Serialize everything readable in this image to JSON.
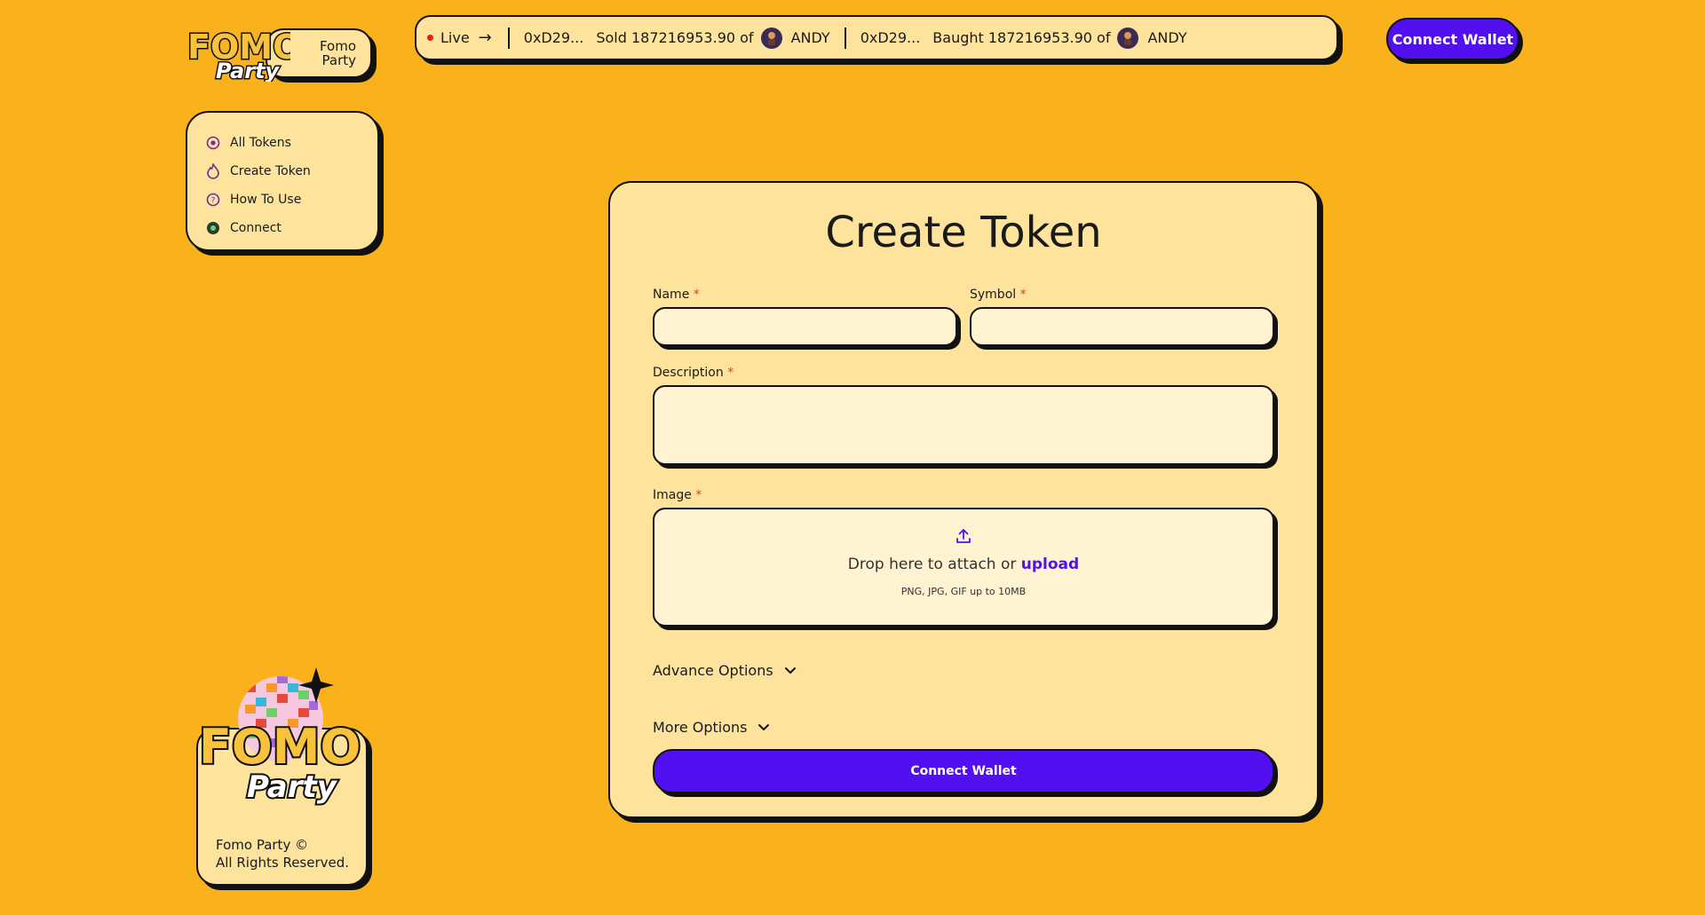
{
  "brand": {
    "logo_alt_words": [
      "FOMO",
      "Party"
    ],
    "tag_line1": "Fomo",
    "tag_line2": "Party"
  },
  "ticker": {
    "live_label": "Live",
    "items": [
      {
        "address": "0xD29...",
        "action": "Sold 187216953.90 of",
        "token": "ANDY"
      },
      {
        "address": "0xD29...",
        "action": "Baught 187216953.90 of",
        "token": "ANDY"
      }
    ]
  },
  "header": {
    "connect_wallet_label": "Connect Wallet"
  },
  "sidebar": {
    "items": [
      {
        "label": "All Tokens",
        "icon": "tokens-icon"
      },
      {
        "label": "Create Token",
        "icon": "flame-icon"
      },
      {
        "label": "How To Use",
        "icon": "question-icon"
      },
      {
        "label": "Connect",
        "icon": "wallet-icon"
      }
    ]
  },
  "footer": {
    "line1": "Fomo Party ©",
    "line2": "All Rights Reserved."
  },
  "form": {
    "title": "Create Token",
    "name_label": "Name",
    "symbol_label": "Symbol",
    "description_label": "Description",
    "image_label": "Image",
    "required_mark": "*",
    "name_value": "",
    "symbol_value": "",
    "description_value": "",
    "upload_text": "Drop here to attach or",
    "upload_link": "upload",
    "upload_hint": "PNG, JPG, GIF up to 10MB",
    "advance_options_label": "Advance Options",
    "more_options_label": "More Options",
    "submit_label": "Connect Wallet"
  },
  "colors": {
    "background": "#f9b21c",
    "card": "#fde39c",
    "input": "#fff3d2",
    "accent": "#520ff0",
    "live_dot": "#e61e1e"
  }
}
